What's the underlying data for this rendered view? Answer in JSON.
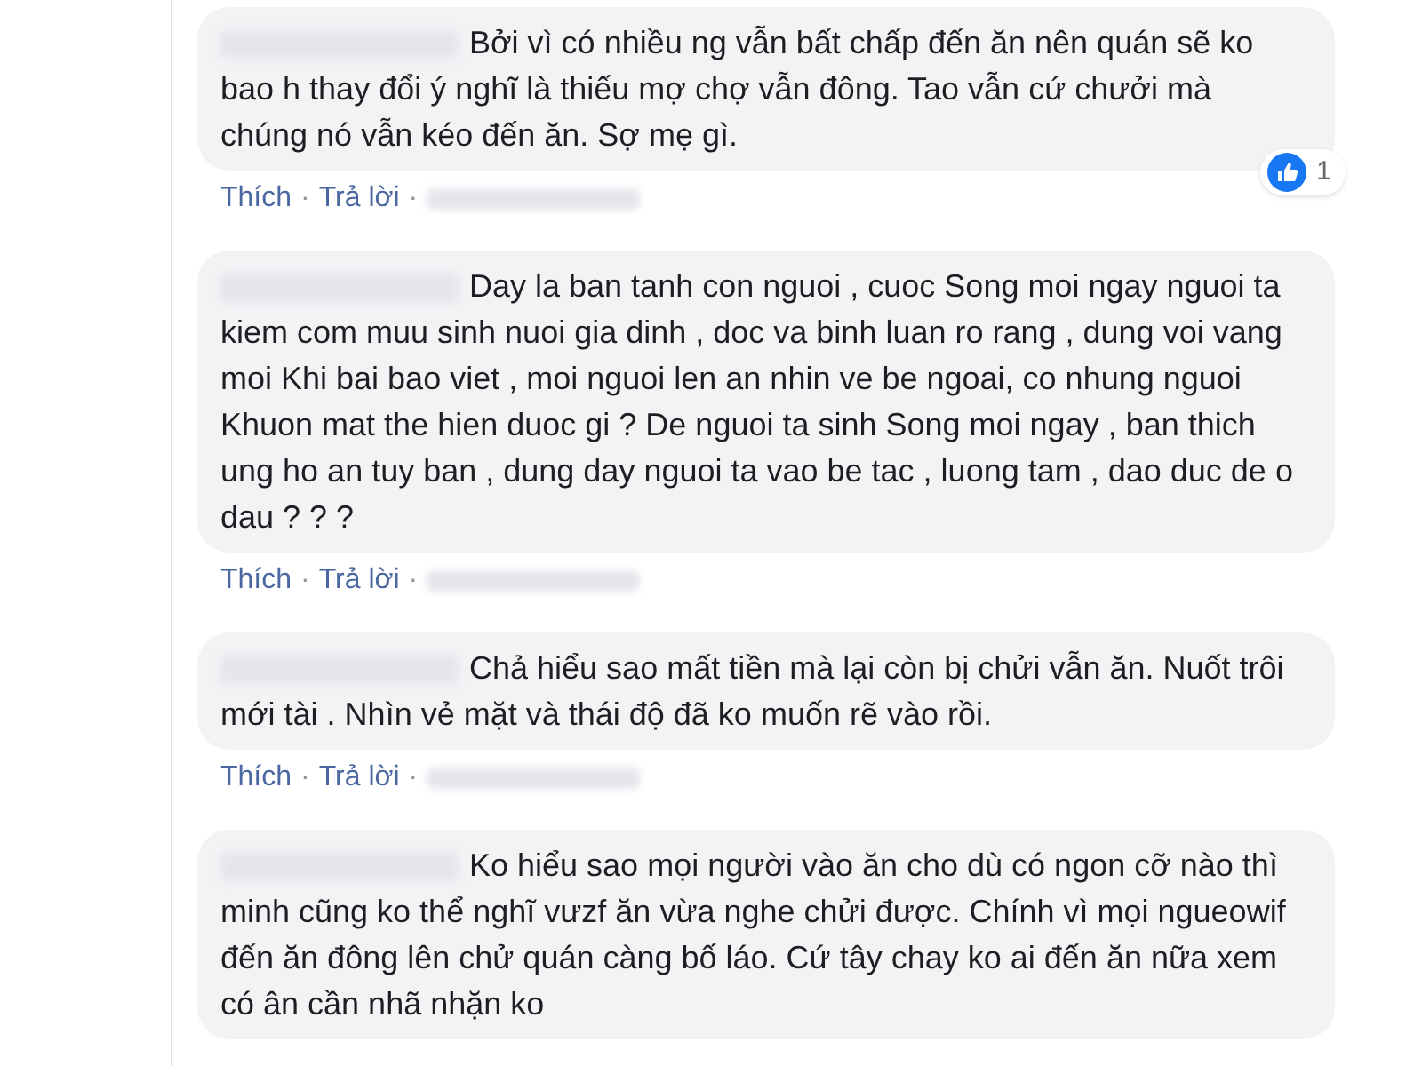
{
  "comments": [
    {
      "text": "Bởi vì có nhiều ng vẫn bất chấp đến ăn nên quán sẽ ko bao h thay đổi ý nghĩ là thiếu mợ chợ vẫn đông. Tao vẫn cứ chưởi mà chúng nó vẫn kéo đến ăn. Sợ mẹ gì.",
      "actions": [
        "Thích",
        "Trả lời"
      ],
      "separator": "·",
      "reaction_count": "1"
    },
    {
      "text": "Day la ban tanh con nguoi , cuoc Song moi ngay nguoi ta kiem com muu sinh nuoi gia dinh , doc va binh luan ro rang , dung voi vang moi Khi bai bao viet , moi nguoi len an nhin ve be ngoai, co nhung nguoi Khuon mat the hien duoc gi ? De nguoi ta sinh Song moi ngay , ban thich ung ho an tuy ban , dung day nguoi ta vao be tac , luong tam , dao duc de o dau ? ? ?",
      "actions": [
        "Thích",
        "Trả lời"
      ],
      "separator": "·"
    },
    {
      "text": "Chả hiểu sao mất tiền mà lại còn bị chửi vẫn ăn. Nuốt trôi mới tài . Nhìn vẻ mặt và thái độ đã ko muốn rẽ vào rồi.",
      "actions": [
        "Thích",
        "Trả lời"
      ],
      "separator": "·"
    },
    {
      "text": "Ko hiểu sao mọi người vào ăn cho dù có ngon cỡ nào thì minh cũng ko thể nghĩ vưzf ăn vừa nghe chửi được. Chính vì mọi ngueowif đến ăn đông lên chử quán càng bố láo. Cứ tây chay ko ai đến ăn nữa xem có ân cần nhã nhặn ko"
    }
  ]
}
